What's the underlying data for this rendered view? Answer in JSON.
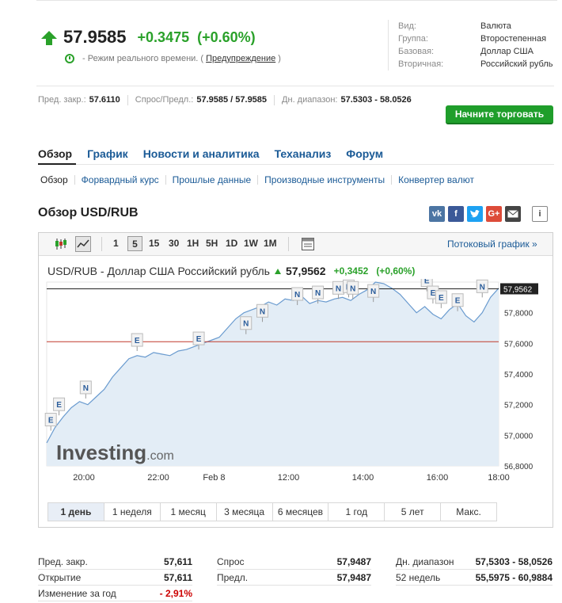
{
  "quote": {
    "price": "57.9585",
    "change": "+0.3475",
    "change_pct": "(+0.60%)",
    "realtime_text": "- Режим реального времени. (",
    "warning_link": "Предупреждение",
    "realtime_close": ")"
  },
  "info": [
    {
      "k": "Вид:",
      "v": "Валюта"
    },
    {
      "k": "Группа:",
      "v": "Второстепенная"
    },
    {
      "k": "Базовая:",
      "v": "Доллар США"
    },
    {
      "k": "Вторичная:",
      "v": "Российский рубль"
    }
  ],
  "stats": {
    "prev_close_label": "Пред. закр.:",
    "prev_close": "57.6110",
    "bid_ask_label": "Спрос/Предл.:",
    "bid_ask": "57.9585 / 57.9585",
    "day_range_label": "Дн. диапазон:",
    "day_range": "57.5303 - 58.0526"
  },
  "trade_button": "Начните торговать",
  "tabs": [
    "Обзор",
    "График",
    "Новости и аналитика",
    "Теханализ",
    "Форум"
  ],
  "subtabs": [
    "Обзор",
    "Форвардный курс",
    "Прошлые данные",
    "Производные инструменты",
    "Конвертер валют"
  ],
  "section_title": "Обзор USD/RUB",
  "share_icons": [
    "vk-icon",
    "facebook-icon",
    "twitter-icon",
    "google-plus-icon",
    "mail-icon",
    "info-icon"
  ],
  "toolbar": {
    "intervals": [
      "1",
      "5",
      "15",
      "30",
      "1H",
      "5H",
      "1D",
      "1W",
      "1M"
    ],
    "selected": "5",
    "stream_link": "Потоковый график »"
  },
  "chart_header": {
    "name": "USD/RUB - Доллар США Российский рубль",
    "price": "57,9562",
    "change": "+0,3452",
    "change_pct": "(+0,60%)"
  },
  "watermark": {
    "main": "Investing",
    "suffix": ".com"
  },
  "ranges": [
    "1 день",
    "1 неделя",
    "1 месяц",
    "3 месяца",
    "6 месяцев",
    "1 год",
    "5 лет",
    "Макс."
  ],
  "chart_data": {
    "type": "area",
    "y_ticks": [
      "57,8000",
      "57,6000",
      "57,4000",
      "57,2000",
      "57,0000",
      "56,8000"
    ],
    "x_ticks": [
      "20:00",
      "22:00",
      "Feb 8",
      "12:00",
      "14:00",
      "16:00",
      "18:00"
    ],
    "ylim": [
      56.8,
      58.0
    ],
    "last_value_label": "57,9562",
    "reference_lines": [
      {
        "value": 57.9562,
        "color": "#222222"
      },
      {
        "value": 57.611,
        "color": "#c0392b"
      }
    ],
    "x": [
      0,
      0.4,
      0.8,
      1.2,
      1.6,
      2.0,
      2.4,
      2.8,
      3.2,
      3.6,
      4.0,
      4.4,
      4.8,
      5.2,
      5.6,
      6.0,
      6.4,
      6.8,
      7.2,
      7.6,
      8.0,
      8.4,
      8.8,
      9.2,
      9.6,
      10.0,
      10.4,
      10.8,
      11.2,
      11.6,
      12.0,
      12.4,
      12.8,
      13.2,
      13.6,
      14.0,
      14.4,
      14.8,
      15.2,
      15.6,
      16.0,
      16.4,
      16.8,
      17.2,
      17.6,
      18.0,
      18.4,
      18.8,
      19.2,
      19.6,
      20.0,
      20.4,
      20.8,
      21.2,
      21.6,
      22.0
    ],
    "values": [
      56.95,
      57.05,
      57.12,
      57.18,
      57.22,
      57.2,
      57.25,
      57.3,
      57.38,
      57.44,
      57.5,
      57.52,
      57.51,
      57.54,
      57.53,
      57.52,
      57.55,
      57.56,
      57.58,
      57.6,
      57.62,
      57.64,
      57.7,
      57.76,
      57.8,
      57.82,
      57.84,
      57.87,
      57.85,
      57.89,
      57.88,
      57.91,
      57.86,
      57.88,
      57.87,
      57.89,
      57.9,
      57.88,
      57.92,
      57.95,
      58.0,
      57.99,
      57.96,
      57.92,
      57.86,
      57.8,
      57.84,
      57.79,
      57.76,
      57.82,
      57.86,
      57.78,
      57.74,
      57.8,
      57.9,
      57.96
    ],
    "event_markers": [
      {
        "x": 0.2,
        "value": 57.03,
        "label": "E"
      },
      {
        "x": 0.6,
        "value": 57.13,
        "label": "E"
      },
      {
        "x": 1.9,
        "value": 57.24,
        "label": "N"
      },
      {
        "x": 4.4,
        "value": 57.55,
        "label": "E"
      },
      {
        "x": 7.4,
        "value": 57.56,
        "label": "E"
      },
      {
        "x": 9.7,
        "value": 57.66,
        "label": "N"
      },
      {
        "x": 10.5,
        "value": 57.74,
        "label": "N"
      },
      {
        "x": 12.2,
        "value": 57.85,
        "label": "N"
      },
      {
        "x": 13.2,
        "value": 57.86,
        "label": "N"
      },
      {
        "x": 14.2,
        "value": 57.89,
        "label": "N"
      },
      {
        "x": 14.7,
        "value": 57.9,
        "label": "N"
      },
      {
        "x": 14.9,
        "value": 57.89,
        "label": "N"
      },
      {
        "x": 15.9,
        "value": 57.87,
        "label": "N"
      },
      {
        "x": 18.5,
        "value": 57.94,
        "label": "E"
      },
      {
        "x": 18.8,
        "value": 57.86,
        "label": "E"
      },
      {
        "x": 19.2,
        "value": 57.83,
        "label": "E"
      },
      {
        "x": 20.0,
        "value": 57.81,
        "label": "E"
      },
      {
        "x": 21.2,
        "value": 57.9,
        "label": "N"
      }
    ]
  },
  "bottom_table": [
    [
      {
        "k": "Пред. закр.",
        "v": "57,611"
      },
      {
        "k": "Спрос",
        "v": "57,9487"
      },
      {
        "k": "Дн. диапазон",
        "v": "57,5303 - 58,0526"
      }
    ],
    [
      {
        "k": "Открытие",
        "v": "57,611"
      },
      {
        "k": "Предл.",
        "v": "57,9487"
      },
      {
        "k": "52 недель",
        "v": "55,5975 - 60,9884"
      }
    ],
    [
      {
        "k": "Изменение за год",
        "v": "- 2,91%",
        "color": "#cc0000"
      }
    ]
  ]
}
